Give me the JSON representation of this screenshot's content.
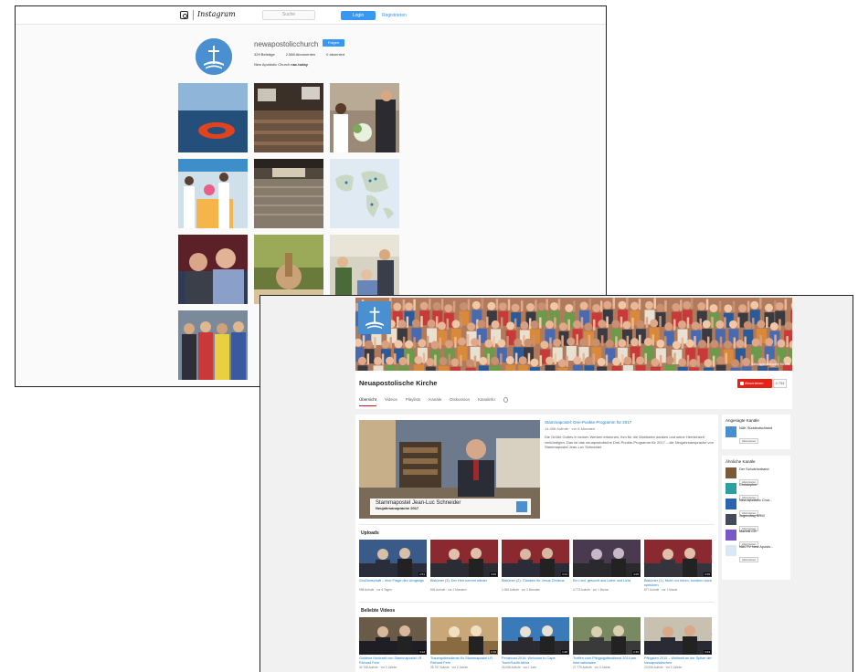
{
  "instagram": {
    "brand": "Instagram",
    "search_placeholder": "Suche",
    "login_label": "Login",
    "register_label": "Registrieren",
    "username": "newapostolicchurch",
    "follow_label": "Folgen",
    "stats": [
      "329 Beiträge",
      "2.588 Abonnenten",
      "0 abonniert"
    ],
    "bio_name": "New Apostolic Church",
    "bio_link": "nac.today"
  },
  "youtube": {
    "banner_channel": "Neuapostolische Kirche",
    "channel_title": "Neuapostolische Kirche",
    "subscribe_label": "Abonnieren",
    "subscriber_count": "4.734",
    "tabs": [
      "Übersicht",
      "Videos",
      "Playlists",
      "Kanäle",
      "Diskussion",
      "Kanalinfo"
    ],
    "featured": {
      "caption_name": "Stammapostel Jean-Luc Schneider",
      "caption_sub": "Neujahrsansprache 2017",
      "title": "Stammapostel: Drei-Punkte-Programm für 2017",
      "views": "14.496 Aufrufe · vor 8 Monaten",
      "description": "Die Größe Gottes in seinen Werken erkennen, ihm für die Wohltaten danken und seine Herrlichkeit verkündigen. Das ist das neuapostolische Drei-Punkte-Programm für 2017 – die Neujahrsansprache von Stammapostel Jean-Luc Schneider."
    },
    "uploads_title": "Uploads",
    "uploads": [
      {
        "title": "Grußbotschaft – eine Frage des Umgangs",
        "meta": "998 Aufrufe · vor 6 Tagen",
        "duration": "2:51"
      },
      {
        "title": "Bistümer (3): Der Herr kommt wieder",
        "meta": "806 Aufrufe · vor 2 Monaten",
        "duration": "3:09"
      },
      {
        "title": "Bistümer (2): Glauben für Jesus Christus",
        "meta": "1.069 Aufrufe · vor 2 Monaten",
        "duration": "3:14"
      },
      {
        "title": "Ein Lied, gesucht aus Liebe und Licht",
        "meta": "4.773 Aufrufe · vor 1 Monat",
        "duration": "4:05"
      },
      {
        "title": "Bistümer (1): Nicht nur hören, sondern auch sprechen",
        "meta": "877 Aufrufe · vor 1 Monat",
        "duration": "3:35"
      }
    ],
    "popular_title": "Beliebte Videos",
    "popular": [
      {
        "title": "Goldene Hochzeit von Stammapostel i.R. Richard Fehr",
        "meta": "44.768 Aufrufe · vor 2 Jahren",
        "duration": "3:12"
      },
      {
        "title": "Trauergottesdienst für Stammapostel i.R. Richard Fehr",
        "meta": "35.797 Aufrufe · vor 2 Jahren",
        "duration": "2:10"
      },
      {
        "title": "Pentecost 2016: Welcome to Cape Town/South Africa",
        "meta": "33.058 Aufrufe · vor 1 Jahr",
        "duration": "1:48"
      },
      {
        "title": "Treffen zum Pfingstgottesdienst 2014 am Internationalen",
        "meta": "27.779 Aufrufe · vor 3 Jahren",
        "duration": "2:46"
      },
      {
        "title": "Pfingsten 2015 – Weltweit an der Spitze der Neuapostolischen",
        "meta": "23.006 Aufrufe · vor 2 Jahren",
        "duration": "3:23"
      }
    ],
    "related_title": "Angesagte Kanäle",
    "related": [
      {
        "name": "NAK Süddeutschland",
        "action": "Abonnieren",
        "color": "#4a8fcf"
      }
    ],
    "similar_title": "Ähnliche Kanäle",
    "similar": [
      {
        "name": "Der Schulchorband",
        "action": "Abonnieren",
        "color": "#7a5a3a"
      },
      {
        "name": "Christopher",
        "action": "Abonnieren",
        "color": "#2aa0a4"
      },
      {
        "name": "New Apostolic Chur...",
        "action": "Abonnieren",
        "color": "#2a66b0"
      },
      {
        "name": "Jugendtag NRW",
        "action": "Abonnieren",
        "color": "#444c5a"
      },
      {
        "name": "Martelli CR",
        "action": "Abonnieren",
        "color": "#7a57c8"
      },
      {
        "name": "NACTV New Aposto...",
        "action": "Abonnieren",
        "color": "#d9e8f5"
      }
    ]
  }
}
